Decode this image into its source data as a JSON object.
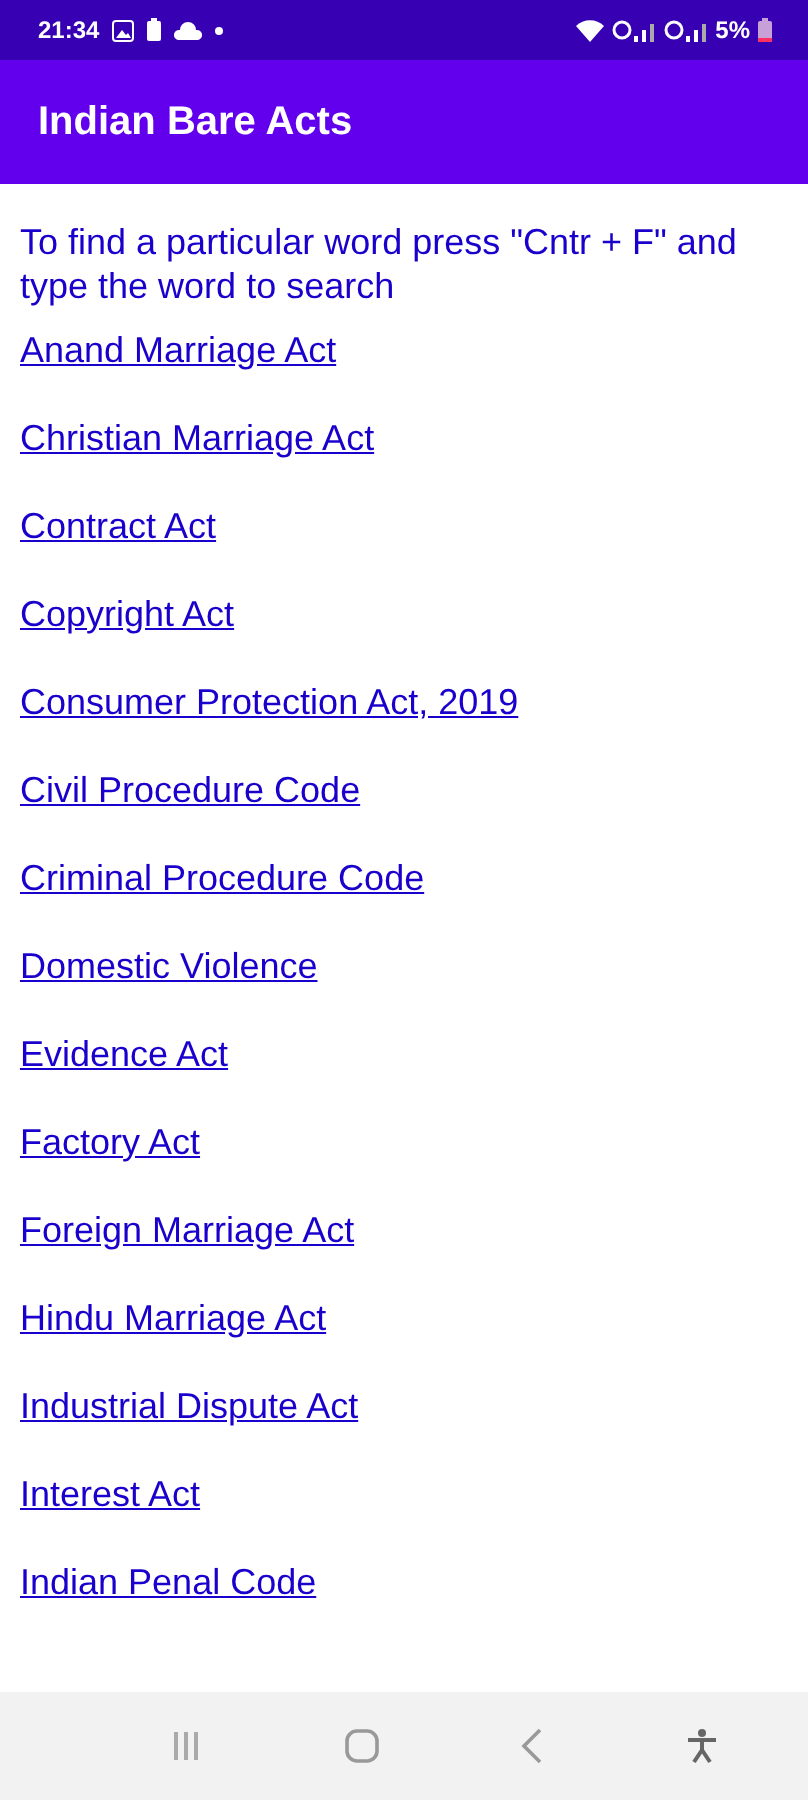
{
  "status_bar": {
    "time": "21:34",
    "battery": "5%"
  },
  "app_bar": {
    "title": "Indian Bare Acts"
  },
  "instructions": "To find a particular word press \"Cntr + F\" and type the word to search",
  "acts": [
    {
      "label": "Anand Marriage Act"
    },
    {
      "label": "Christian Marriage Act"
    },
    {
      "label": "Contract Act"
    },
    {
      "label": "Copyright Act"
    },
    {
      "label": "Consumer Protection Act, 2019"
    },
    {
      "label": "Civil Procedure Code"
    },
    {
      "label": "Criminal Procedure Code"
    },
    {
      "label": "Domestic Violence"
    },
    {
      "label": "Evidence Act"
    },
    {
      "label": "Factory Act"
    },
    {
      "label": "Foreign Marriage Act"
    },
    {
      "label": "Hindu Marriage Act"
    },
    {
      "label": "Industrial Dispute Act"
    },
    {
      "label": "Interest Act"
    },
    {
      "label": "Indian Penal Code"
    }
  ]
}
